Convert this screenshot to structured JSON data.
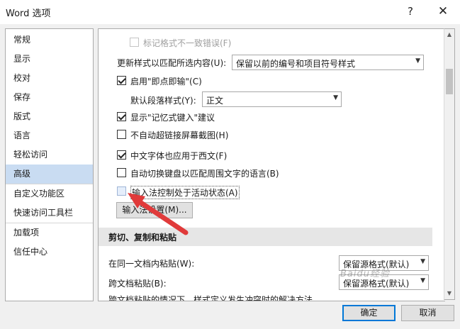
{
  "window": {
    "title": "Word 选项",
    "help_glyph": "?",
    "close_glyph": "✕"
  },
  "sidebar": {
    "items": [
      {
        "label": "常规"
      },
      {
        "label": "显示"
      },
      {
        "label": "校对"
      },
      {
        "label": "保存"
      },
      {
        "label": "版式"
      },
      {
        "label": "语言"
      },
      {
        "label": "轻松访问"
      },
      {
        "label": "高级",
        "active": true
      },
      {
        "label": "自定义功能区"
      },
      {
        "label": "快速访问工具栏"
      },
      {
        "label": "加载项"
      },
      {
        "label": "信任中心"
      }
    ]
  },
  "options": {
    "mark_format": {
      "label": "标记格式不一致错误(F)",
      "checked": false,
      "disabled": true
    },
    "update_style": {
      "label": "更新样式以匹配所选内容(U):",
      "value": "保留以前的编号和项目符号样式"
    },
    "click_type": {
      "label": "启用\"即点即输\"(C)",
      "checked": true
    },
    "default_para": {
      "label": "默认段落样式(Y):",
      "value": "正文"
    },
    "autocomplete": {
      "label": "显示\"记忆式键入\"建议",
      "checked": true
    },
    "no_hyperlink": {
      "label": "不自动超链接屏幕截图(H)",
      "checked": false
    },
    "cjk_font_western": {
      "label": "中文字体也应用于西文(F)",
      "checked": true
    },
    "auto_keyboard": {
      "label": "自动切换键盘以匹配周围文字的语言(B)",
      "checked": false
    },
    "ime_control": {
      "label": "输入法控制处于活动状态(A)",
      "checked": false
    },
    "ime_settings_button": "输入法设置(M)..."
  },
  "paste_section": {
    "heading": "剪切、复制和粘贴",
    "within_doc": {
      "label": "在同一文档内粘贴(W):",
      "value": "保留源格式(默认)"
    },
    "cross_doc": {
      "label": "跨文档粘贴(B):",
      "value": "保留源格式(默认)"
    },
    "conflict": {
      "label": "跨文档粘贴的情况下，样式定义发生冲突时的解决方法"
    }
  },
  "footer": {
    "ok": "确定",
    "cancel": "取消"
  },
  "watermark": "Baidu经验",
  "colors": {
    "accent": "#0078d7",
    "active_nav": "#c9dcf2",
    "arrow": "#e03a3a"
  }
}
